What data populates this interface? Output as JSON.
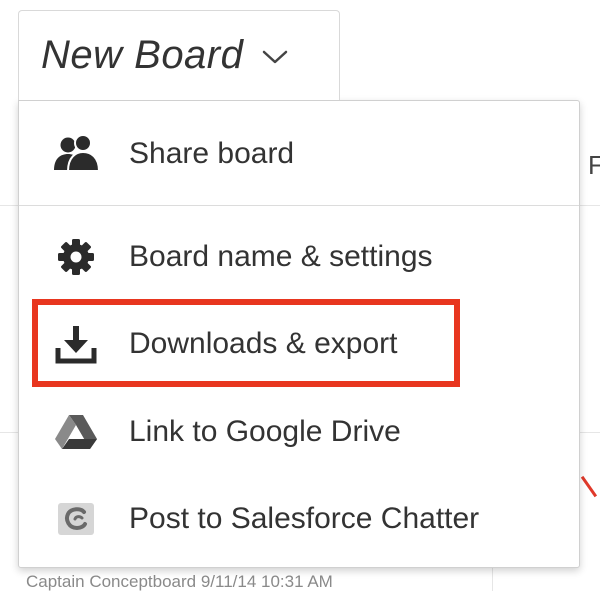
{
  "board": {
    "title": "New Board",
    "chevron_icon": "chevron-down-icon"
  },
  "menu": {
    "items": [
      {
        "id": "share",
        "label": "Share board",
        "icon": "users-icon"
      },
      {
        "id": "settings",
        "label": "Board name & settings",
        "icon": "gear-icon"
      },
      {
        "id": "downloads",
        "label": "Downloads & export",
        "icon": "download-icon",
        "highlighted": true
      },
      {
        "id": "gdrive",
        "label": "Link to Google Drive",
        "icon": "google-drive-icon"
      },
      {
        "id": "salesforce",
        "label": "Post to Salesforce Chatter",
        "icon": "salesforce-chatter-icon"
      }
    ]
  },
  "background": {
    "partial_letter": "F",
    "footer_text": "Captain Conceptboard 9/11/14 10:31 AM"
  },
  "colors": {
    "highlight": "#e8361f",
    "text": "#333333",
    "icon": "#2b2b2b"
  }
}
